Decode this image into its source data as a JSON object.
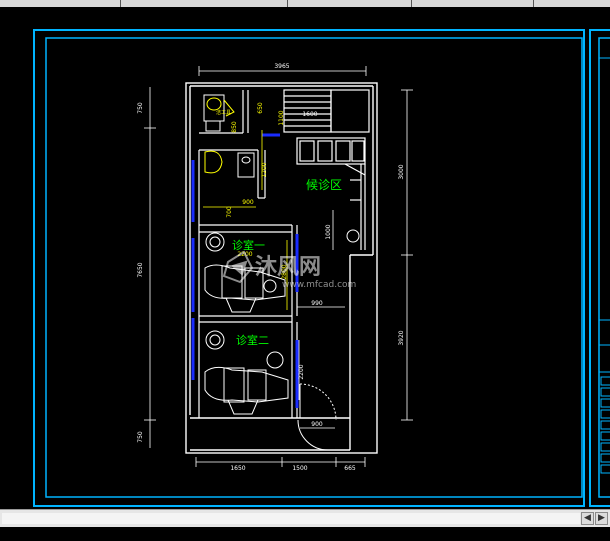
{
  "drawing": {
    "room_waiting": "候诊区",
    "room_clinic_1": "诊室一",
    "room_clinic_2": "诊室二",
    "small_label": "洁工具",
    "dim_top": "3965",
    "dim_left_total": "7650",
    "dim_left_top": "750",
    "dim_left_bottom": "750",
    "dim_right_upper": "3000",
    "dim_right_lower": "3920",
    "dim_bottom_left": "1650",
    "dim_bottom_mid": "1500",
    "dim_bottom_right": "665",
    "dim_1100": "1100",
    "dim_650": "650",
    "dim_850": "850",
    "dim_1200": "1200",
    "dim_900a": "900",
    "dim_900b": "900",
    "dim_990": "990",
    "dim_700": "700",
    "dim_1000": "1000",
    "dim_2800": "2800",
    "dim_2200": "2200",
    "dim_2200b": "2200",
    "dim_1600": "1600"
  },
  "watermark": {
    "brand": "沐风网",
    "url": "www.mfcad.com"
  },
  "colors": {
    "frame": "#00b4ff",
    "walls": "#ffffff",
    "dimension": "#ffff00",
    "room_label": "#00ff00",
    "door_blue": "#1a2cff",
    "background": "#000000"
  }
}
